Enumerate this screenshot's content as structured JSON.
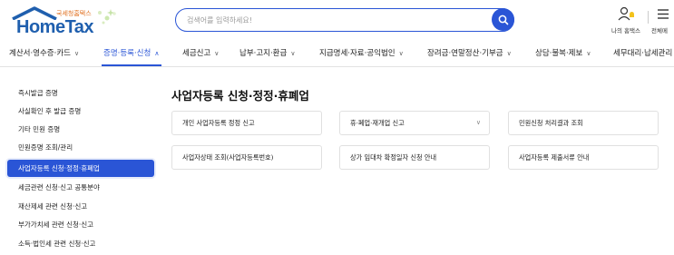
{
  "header": {
    "logo_small_text": "국세청홈택스",
    "logo_text": "HomeTax",
    "search_placeholder": "검색어를 입력하세요!",
    "my_hometax_label": "나의 홈택스",
    "all_menu_label": "전체메",
    "brand_color": "#1f5fae",
    "accent_color": "#2a55d6"
  },
  "nav": {
    "items": [
      {
        "label": "계산서·영수증·카드",
        "icon": "chevron-down-icon"
      },
      {
        "label": "증명·등록·신청",
        "icon": "chevron-up-icon"
      },
      {
        "label": "세금신고",
        "icon": "chevron-down-icon"
      },
      {
        "label": "납부·고지·환급",
        "icon": "chevron-down-icon"
      },
      {
        "label": "지급명세·자료·공익법인",
        "icon": "chevron-down-icon"
      },
      {
        "label": "장려금·연말정산·기부금",
        "icon": "chevron-down-icon"
      },
      {
        "label": "상담·불복·제보",
        "icon": "chevron-down-icon"
      },
      {
        "label": "세무대리·납세관리",
        "icon": ""
      }
    ]
  },
  "sidebar": {
    "items": [
      {
        "label": "즉시발급 증명"
      },
      {
        "label": "사실확인 후 발급 증명"
      },
      {
        "label": "기타 민원 증명"
      },
      {
        "label": "민원증명 조회/관리"
      },
      {
        "label": "사업자등록 신청·정정·휴폐업"
      },
      {
        "label": "세금관련 신청·신고 공통분야"
      },
      {
        "label": "재산제세 관련 신청·신고"
      },
      {
        "label": "부가가치세 관련 신청·신고"
      },
      {
        "label": "소득·법인세 관련 신청·신고"
      }
    ]
  },
  "main": {
    "title": "사업자등록 신청·정정·휴폐업",
    "cards": [
      {
        "label": "개인 사업자등록 정정 신고"
      },
      {
        "label": "휴·폐업·재개업 신고",
        "icon": "chevron-down-icon"
      },
      {
        "label": "민원신청 처리결과 조회"
      },
      {
        "label": "사업자상태 조회(사업자등록번호)"
      },
      {
        "label": "상가 임대차 확정일자 신청 안내"
      },
      {
        "label": "사업자등록 제출서류 안내"
      }
    ]
  }
}
